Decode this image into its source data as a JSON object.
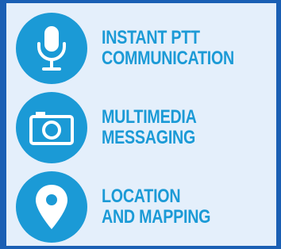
{
  "colors": {
    "frame": "#1a5fb4",
    "panel": "#e4effb",
    "accent": "#1b9ad6",
    "icon": "#ffffff"
  },
  "features": [
    {
      "icon": "microphone-icon",
      "line1": "INSTANT PTT",
      "line2": "COMMUNICATION"
    },
    {
      "icon": "camera-icon",
      "line1": "MULTIMEDIA",
      "line2": "MESSAGING"
    },
    {
      "icon": "map-pin-icon",
      "line1": "LOCATION",
      "line2": "AND MAPPING"
    }
  ]
}
